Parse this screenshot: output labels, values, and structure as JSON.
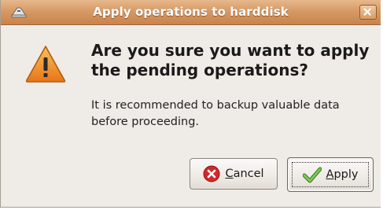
{
  "window": {
    "title": "Apply operations to harddisk"
  },
  "dialog": {
    "headline": "Are you sure you want to apply the pending operations?",
    "body": "It is recommended to backup valuable data before proceeding."
  },
  "buttons": {
    "cancel": {
      "mnemonic": "C",
      "rest": "ancel"
    },
    "apply": {
      "mnemonic": "A",
      "rest": "pply"
    }
  },
  "colors": {
    "titlebar": "#d69a66",
    "dialog_bg": "#efebe7",
    "warning": "#f39c2a",
    "cancel_icon": "#d12a2a",
    "apply_icon": "#5aa83a"
  },
  "icons": {
    "app": "harddisk-app-icon",
    "close": "close-icon",
    "warning": "warning-icon",
    "cancel": "cancel-icon",
    "apply": "checkmark-icon"
  }
}
